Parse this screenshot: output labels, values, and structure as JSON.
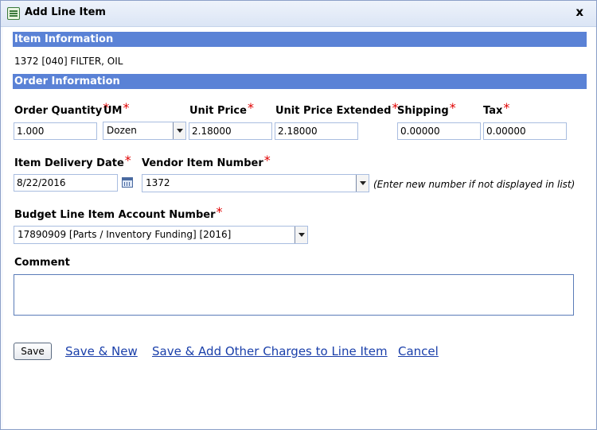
{
  "window": {
    "title": "Add Line Item",
    "close_glyph": "x"
  },
  "sections": {
    "item_information": "Item Information",
    "order_information": "Order Information"
  },
  "item": {
    "description": "1372 [040] FILTER, OIL"
  },
  "labels": {
    "order_quantity": "Order Quantity",
    "um": "UM",
    "unit_price": "Unit Price",
    "unit_price_extended": "Unit Price Extended",
    "shipping": "Shipping",
    "tax": "Tax",
    "item_delivery_date": "Item Delivery Date",
    "vendor_item_number": "Vendor Item Number",
    "budget_line_item_account_number": "Budget Line Item Account Number",
    "comment": "Comment",
    "required_marker": "*"
  },
  "fields": {
    "order_quantity": "1.000",
    "um": "Dozen",
    "unit_price": "2.18000",
    "unit_price_extended": "2.18000",
    "shipping": "0.00000",
    "tax": "0.00000",
    "item_delivery_date": "8/22/2016",
    "vendor_item_number": "1372",
    "budget_line_item_account_number": "17890909 [Parts / Inventory Funding] [2016]",
    "comment": ""
  },
  "hints": {
    "vendor_item_number": "(Enter new number if not displayed in list)"
  },
  "actions": {
    "save": "Save",
    "save_new": "Save & New",
    "save_add_other_charges": "Save & Add Other Charges to Line Item",
    "cancel": "Cancel"
  },
  "icons": {
    "title": "document-list-icon",
    "close": "close-icon",
    "calendar": "calendar-icon",
    "dropdown": "chevron-down-icon"
  },
  "colors": {
    "section_bar": "#5a82d6",
    "required": "#e00000",
    "link": "#1a3faa"
  }
}
